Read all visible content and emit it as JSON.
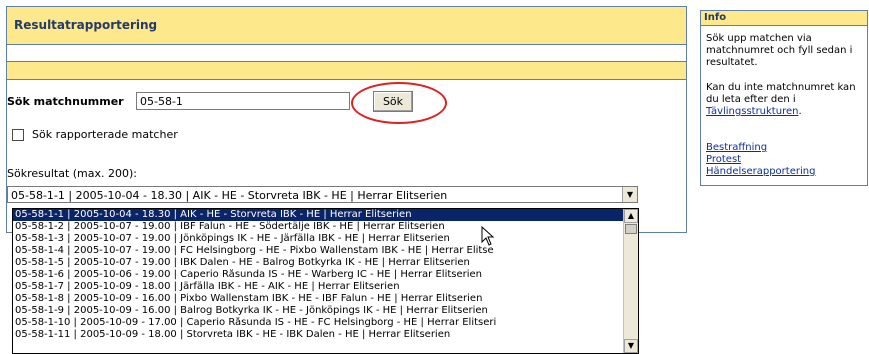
{
  "main": {
    "title": "Resultatrapportering",
    "search_label": "Sök matchnummer",
    "search_value": "05-58-1",
    "search_button": "Sök",
    "checkbox_label": "Sök rapporterade matcher",
    "results_label": "Sökresultat (max. 200):",
    "selected_value": "05-58-1-1 | 2005-10-04 - 18.30 | AIK - HE - Storvreta IBK - HE | Herrar Elitserien"
  },
  "dropdown": {
    "options": [
      "05-58-1-1 | 2005-10-04 - 18.30 | AIK - HE - Storvreta IBK - HE | Herrar Elitserien",
      "05-58-1-2 | 2005-10-07 - 19.00 | IBF Falun - HE - Södertälje IBK - HE | Herrar Elitserien",
      "05-58-1-3 | 2005-10-07 - 19.00 | Jönköpings IK - HE - Järfälla IBK - HE | Herrar Elitserien",
      "05-58-1-4 | 2005-10-07 - 19.00 | FC Helsingborg - HE - Pixbo Wallenstam IBK - HE | Herrar Elitse",
      "05-58-1-5 | 2005-10-07 - 19.00 | IBK Dalen - HE - Balrog Botkyrka IK - HE | Herrar Elitserien",
      "05-58-1-6 | 2005-10-06 - 19.00 | Caperio Råsunda IS - HE - Warberg IC - HE | Herrar Elitserien",
      "05-58-1-7 | 2005-10-09 - 18.00 | Järfälla IBK - HE - AIK - HE | Herrar Elitserien",
      "05-58-1-8 | 2005-10-09 - 16.00 | Pixbo Wallenstam IBK - HE - IBF Falun - HE | Herrar Elitserien",
      "05-58-1-9 | 2005-10-09 - 16.00 | Balrog Botkyrka IK - HE - Jönköpings IK - HE | Herrar Elitserien",
      "05-58-1-10 | 2005-10-09 - 17.00 | Caperio Råsunda IS - HE - FC Helsingborg - HE | Herrar Elitseri",
      "05-58-1-11 | 2005-10-09 - 18.00 | Storvreta IBK - HE - IBK Dalen - HE | Herrar Elitserien"
    ],
    "selected_index": 0
  },
  "info": {
    "header": "Info",
    "paragraph1": "Sök upp matchen via matchnumret och fyll sedan i resultatet.",
    "paragraph2": "Kan du inte matchnumret kan du leta efter den i",
    "structure_link": "Tävlingsstrukturen",
    "after_link": ".",
    "links": [
      "Bestraffning",
      "Protest",
      "Händelserapportering"
    ]
  },
  "colors": {
    "panel_yellow": "#fde98c",
    "border_blue": "#5f7fa8",
    "highlight_red": "#e02020",
    "selection_navy": "#0a246a"
  },
  "icons": [
    "dropdown-arrow-icon",
    "scroll-up-icon",
    "scroll-down-icon",
    "mouse-cursor-icon"
  ]
}
